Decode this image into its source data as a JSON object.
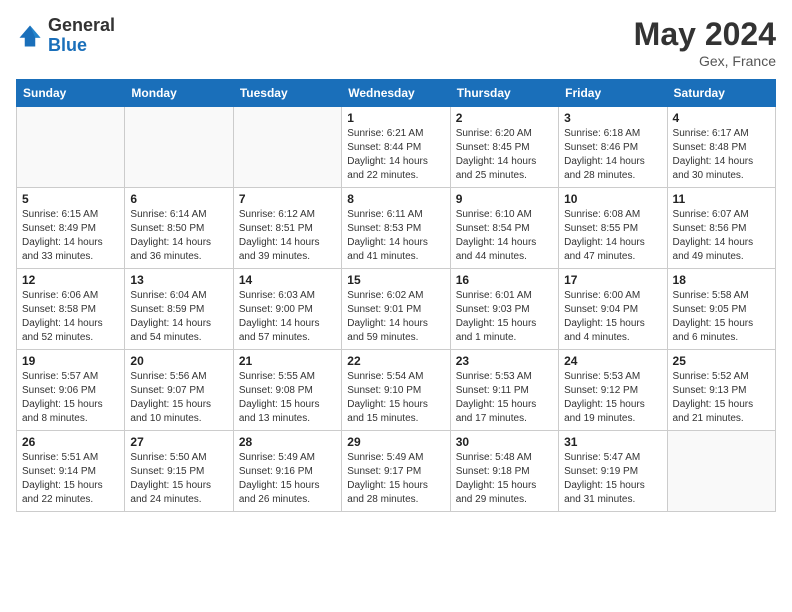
{
  "header": {
    "logo_general": "General",
    "logo_blue": "Blue",
    "month_title": "May 2024",
    "location": "Gex, France"
  },
  "weekdays": [
    "Sunday",
    "Monday",
    "Tuesday",
    "Wednesday",
    "Thursday",
    "Friday",
    "Saturday"
  ],
  "weeks": [
    [
      {
        "day": "",
        "info": ""
      },
      {
        "day": "",
        "info": ""
      },
      {
        "day": "",
        "info": ""
      },
      {
        "day": "1",
        "info": "Sunrise: 6:21 AM\nSunset: 8:44 PM\nDaylight: 14 hours\nand 22 minutes."
      },
      {
        "day": "2",
        "info": "Sunrise: 6:20 AM\nSunset: 8:45 PM\nDaylight: 14 hours\nand 25 minutes."
      },
      {
        "day": "3",
        "info": "Sunrise: 6:18 AM\nSunset: 8:46 PM\nDaylight: 14 hours\nand 28 minutes."
      },
      {
        "day": "4",
        "info": "Sunrise: 6:17 AM\nSunset: 8:48 PM\nDaylight: 14 hours\nand 30 minutes."
      }
    ],
    [
      {
        "day": "5",
        "info": "Sunrise: 6:15 AM\nSunset: 8:49 PM\nDaylight: 14 hours\nand 33 minutes."
      },
      {
        "day": "6",
        "info": "Sunrise: 6:14 AM\nSunset: 8:50 PM\nDaylight: 14 hours\nand 36 minutes."
      },
      {
        "day": "7",
        "info": "Sunrise: 6:12 AM\nSunset: 8:51 PM\nDaylight: 14 hours\nand 39 minutes."
      },
      {
        "day": "8",
        "info": "Sunrise: 6:11 AM\nSunset: 8:53 PM\nDaylight: 14 hours\nand 41 minutes."
      },
      {
        "day": "9",
        "info": "Sunrise: 6:10 AM\nSunset: 8:54 PM\nDaylight: 14 hours\nand 44 minutes."
      },
      {
        "day": "10",
        "info": "Sunrise: 6:08 AM\nSunset: 8:55 PM\nDaylight: 14 hours\nand 47 minutes."
      },
      {
        "day": "11",
        "info": "Sunrise: 6:07 AM\nSunset: 8:56 PM\nDaylight: 14 hours\nand 49 minutes."
      }
    ],
    [
      {
        "day": "12",
        "info": "Sunrise: 6:06 AM\nSunset: 8:58 PM\nDaylight: 14 hours\nand 52 minutes."
      },
      {
        "day": "13",
        "info": "Sunrise: 6:04 AM\nSunset: 8:59 PM\nDaylight: 14 hours\nand 54 minutes."
      },
      {
        "day": "14",
        "info": "Sunrise: 6:03 AM\nSunset: 9:00 PM\nDaylight: 14 hours\nand 57 minutes."
      },
      {
        "day": "15",
        "info": "Sunrise: 6:02 AM\nSunset: 9:01 PM\nDaylight: 14 hours\nand 59 minutes."
      },
      {
        "day": "16",
        "info": "Sunrise: 6:01 AM\nSunset: 9:03 PM\nDaylight: 15 hours\nand 1 minute."
      },
      {
        "day": "17",
        "info": "Sunrise: 6:00 AM\nSunset: 9:04 PM\nDaylight: 15 hours\nand 4 minutes."
      },
      {
        "day": "18",
        "info": "Sunrise: 5:58 AM\nSunset: 9:05 PM\nDaylight: 15 hours\nand 6 minutes."
      }
    ],
    [
      {
        "day": "19",
        "info": "Sunrise: 5:57 AM\nSunset: 9:06 PM\nDaylight: 15 hours\nand 8 minutes."
      },
      {
        "day": "20",
        "info": "Sunrise: 5:56 AM\nSunset: 9:07 PM\nDaylight: 15 hours\nand 10 minutes."
      },
      {
        "day": "21",
        "info": "Sunrise: 5:55 AM\nSunset: 9:08 PM\nDaylight: 15 hours\nand 13 minutes."
      },
      {
        "day": "22",
        "info": "Sunrise: 5:54 AM\nSunset: 9:10 PM\nDaylight: 15 hours\nand 15 minutes."
      },
      {
        "day": "23",
        "info": "Sunrise: 5:53 AM\nSunset: 9:11 PM\nDaylight: 15 hours\nand 17 minutes."
      },
      {
        "day": "24",
        "info": "Sunrise: 5:53 AM\nSunset: 9:12 PM\nDaylight: 15 hours\nand 19 minutes."
      },
      {
        "day": "25",
        "info": "Sunrise: 5:52 AM\nSunset: 9:13 PM\nDaylight: 15 hours\nand 21 minutes."
      }
    ],
    [
      {
        "day": "26",
        "info": "Sunrise: 5:51 AM\nSunset: 9:14 PM\nDaylight: 15 hours\nand 22 minutes."
      },
      {
        "day": "27",
        "info": "Sunrise: 5:50 AM\nSunset: 9:15 PM\nDaylight: 15 hours\nand 24 minutes."
      },
      {
        "day": "28",
        "info": "Sunrise: 5:49 AM\nSunset: 9:16 PM\nDaylight: 15 hours\nand 26 minutes."
      },
      {
        "day": "29",
        "info": "Sunrise: 5:49 AM\nSunset: 9:17 PM\nDaylight: 15 hours\nand 28 minutes."
      },
      {
        "day": "30",
        "info": "Sunrise: 5:48 AM\nSunset: 9:18 PM\nDaylight: 15 hours\nand 29 minutes."
      },
      {
        "day": "31",
        "info": "Sunrise: 5:47 AM\nSunset: 9:19 PM\nDaylight: 15 hours\nand 31 minutes."
      },
      {
        "day": "",
        "info": ""
      }
    ]
  ]
}
